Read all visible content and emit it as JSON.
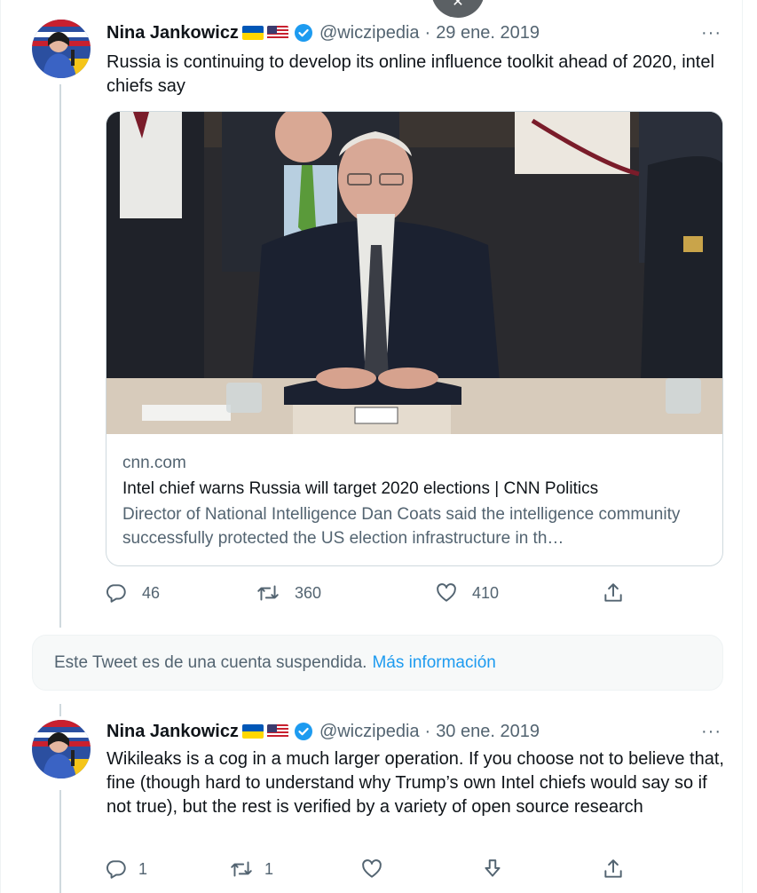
{
  "colors": {
    "text_primary": "#0f1419",
    "text_secondary": "#536471",
    "link": "#1d9bf0",
    "verified": "#1d9bf0",
    "border": "#cfd9de",
    "suspended_bg": "#f7f9f9"
  },
  "overlay": {
    "close_icon": "close-icon",
    "close_glyph": "✕"
  },
  "tweets": [
    {
      "author": {
        "name": "Nina Jankowicz",
        "flags": [
          "ukraine-flag-icon",
          "us-flag-icon"
        ],
        "verified": true,
        "handle": "@wiczipedia"
      },
      "separator": "·",
      "date": "29 ene. 2019",
      "more_glyph": "···",
      "text": "Russia is continuing to develop its online influence toolkit ahead of 2020, intel chiefs say",
      "card": {
        "domain": "cnn.com",
        "title": "Intel chief warns Russia will target 2020 elections | CNN Politics",
        "description": "Director of National Intelligence Dan Coats said the intelligence community successfully protected the US election infrastructure in th…"
      },
      "actions": {
        "reply": {
          "icon": "reply-icon",
          "count": "46"
        },
        "retweet": {
          "icon": "retweet-icon",
          "count": "360"
        },
        "like": {
          "icon": "heart-icon",
          "count": "410"
        },
        "share": {
          "icon": "share-icon",
          "count": ""
        }
      }
    },
    {
      "author": {
        "name": "Nina Jankowicz",
        "flags": [
          "ukraine-flag-icon",
          "us-flag-icon"
        ],
        "verified": true,
        "handle": "@wiczipedia"
      },
      "separator": "·",
      "date": "30 ene. 2019",
      "more_glyph": "···",
      "text": "Wikileaks is a cog in a much larger operation. If you choose not to believe that, fine (though hard to understand why Trump’s own Intel chiefs would say so if not true), but the rest is verified by a variety of open source research",
      "actions": {
        "reply": {
          "icon": "reply-icon",
          "count": "1"
        },
        "retweet": {
          "icon": "retweet-icon",
          "count": "1"
        },
        "like": {
          "icon": "heart-icon",
          "count": ""
        },
        "tip": {
          "icon": "arrow-down-icon",
          "count": ""
        },
        "share": {
          "icon": "share-icon",
          "count": ""
        }
      }
    }
  ],
  "suspended": {
    "text": "Este Tweet es de una cuenta suspendida.",
    "link": "Más información"
  }
}
